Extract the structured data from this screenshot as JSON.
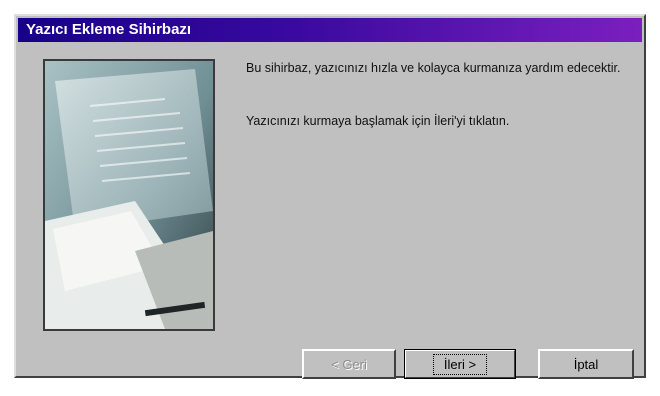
{
  "window": {
    "title": "Yazıcı Ekleme Sihirbazı"
  },
  "content": {
    "intro": "Bu sihirbaz, yazıcınızı hızla ve kolayca kurmanıza yardım edecektir.",
    "instruction": "Yazıcınızı kurmaya başlamak için İleri'yi tıklatın."
  },
  "buttons": {
    "back": "< Geri",
    "next": "İleri >",
    "cancel": "İptal"
  },
  "colors": {
    "titlebar_start": "#17008a",
    "titlebar_end": "#7b1fbf",
    "dialog_background": "#c0c0c0"
  }
}
